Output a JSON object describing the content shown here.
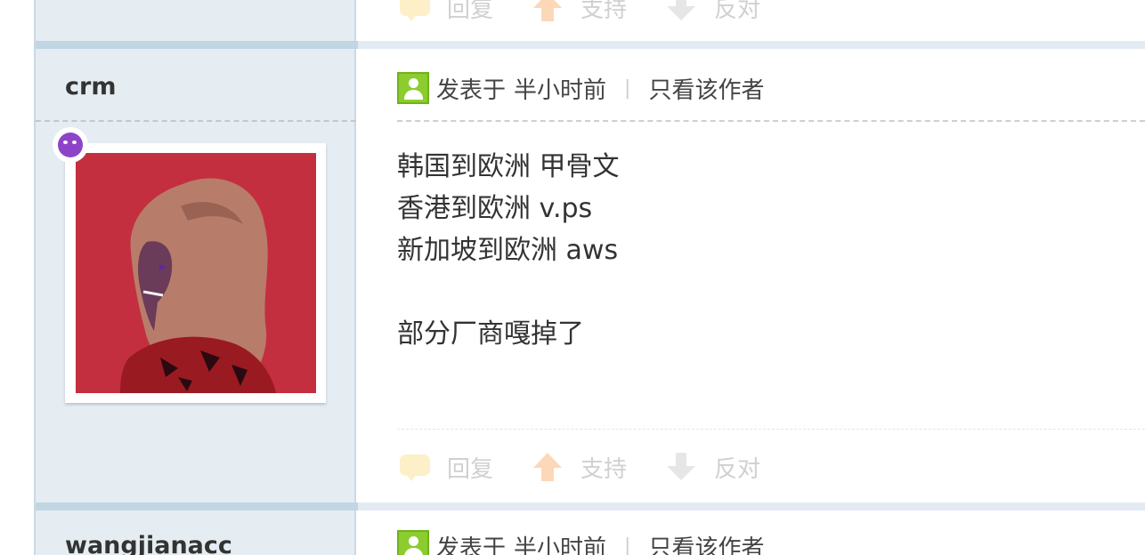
{
  "posts": [
    {
      "actions": {
        "reply": "回复",
        "support": "支持",
        "oppose": "反对"
      }
    },
    {
      "username": "crm",
      "meta": {
        "posted_prefix": "发表于",
        "time": "半小时前",
        "separator": "|",
        "only_author": "只看该作者"
      },
      "content_lines": [
        "韩国到欧洲 甲骨文",
        "香港到欧洲 v.ps",
        "新加坡到欧洲 aws",
        "",
        "部分厂商嘎掉了"
      ],
      "actions": {
        "reply": "回复",
        "support": "支持",
        "oppose": "反对"
      }
    },
    {
      "username": "wangjianacc",
      "meta": {
        "posted_prefix": "发表于",
        "time": "半小时前",
        "separator": "|",
        "only_author": "只看该作者"
      }
    }
  ],
  "colors": {
    "sidebar_bg": "#e5edf2",
    "separator": "#c2d5e3",
    "avatar_bg": "#c42f3f",
    "badge": "#8e44c8"
  },
  "icons": {
    "reply": "reply-bubble-icon",
    "support": "thumb-up-arrow-icon",
    "oppose": "down-arrow-icon",
    "author": "user-icon",
    "badge": "emoji-badge-icon"
  }
}
